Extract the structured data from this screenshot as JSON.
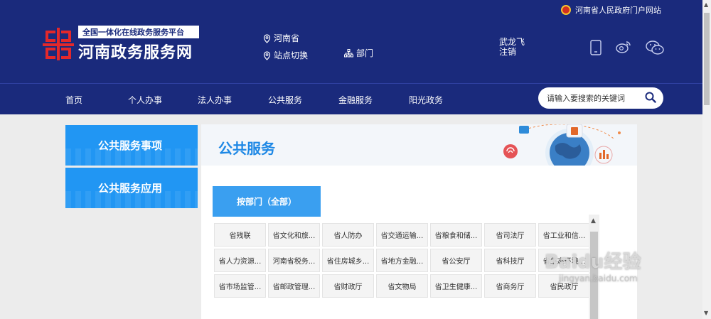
{
  "header": {
    "gov_link": "河南省人民政府门户网站",
    "logo_tagline": "全国一体化在线政务服务平台",
    "logo_name": "河南政务服务网",
    "location": "河南省",
    "switch_site": "站点切换",
    "department": "部门",
    "username": "武龙飞",
    "logout": "注销",
    "icons": [
      "mobile-icon",
      "weibo-icon",
      "wechat-icon"
    ]
  },
  "nav": {
    "items": [
      "首页",
      "个人办事",
      "法人办事",
      "公共服务",
      "金融服务",
      "阳光政务"
    ],
    "search_placeholder": "请输入要搜索的关键词"
  },
  "sidebar": {
    "items": [
      "公共服务事项",
      "公共服务应用"
    ]
  },
  "main": {
    "title": "公共服务",
    "tab": "按部门（全部）",
    "departments": [
      "省残联",
      "省文化和旅...",
      "省人防办",
      "省交通运输...",
      "省粮食和储...",
      "省司法厅",
      "省工业和信...",
      "省人力资源...",
      "河南省税务...",
      "省住房城乡...",
      "省地方金融...",
      "省公安厅",
      "省科技厅",
      "省生态环境...",
      "省市场监管...",
      "省邮政管理...",
      "省财政厅",
      "省文物局",
      "省卫生健康...",
      "省商务厅",
      "省民政厅"
    ]
  },
  "watermark": {
    "brand": "Baidu经验",
    "url": "jingyan.baidu.com"
  },
  "colors": {
    "header_bg": "#1a2a7c",
    "accent_blue": "#2196f3",
    "title_blue": "#1e88e5",
    "logo_red": "#e3282b"
  }
}
